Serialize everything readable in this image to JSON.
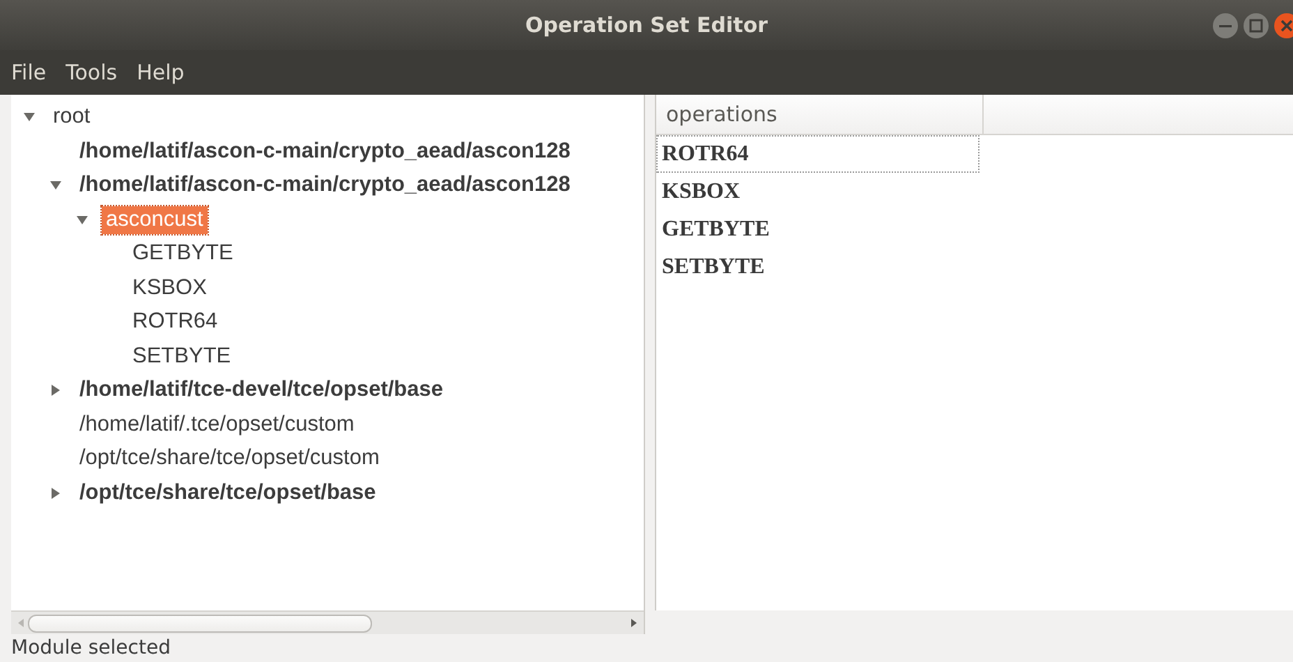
{
  "window": {
    "title": "Operation Set Editor"
  },
  "menu": [
    "File",
    "Tools",
    "Help"
  ],
  "tree": [
    {
      "label": "root",
      "bold": false,
      "expanded": true,
      "selected": false,
      "children": [
        {
          "label": "/home/latif/ascon-c-main/crypto_aead/ascon128",
          "bold": true,
          "selected": false
        },
        {
          "label": "/home/latif/ascon-c-main/crypto_aead/ascon128",
          "bold": true,
          "expanded": true,
          "selected": false,
          "children": [
            {
              "label": "asconcust",
              "bold": false,
              "expanded": true,
              "selected": true,
              "children": [
                {
                  "label": "GETBYTE",
                  "bold": false,
                  "selected": false
                },
                {
                  "label": "KSBOX",
                  "bold": false,
                  "selected": false
                },
                {
                  "label": "ROTR64",
                  "bold": false,
                  "selected": false
                },
                {
                  "label": "SETBYTE",
                  "bold": false,
                  "selected": false
                }
              ]
            }
          ]
        },
        {
          "label": "/home/latif/tce-devel/tce/opset/base",
          "bold": true,
          "expanded": false,
          "selected": false
        },
        {
          "label": "/home/latif/.tce/opset/custom",
          "bold": false,
          "selected": false
        },
        {
          "label": "/opt/tce/share/tce/opset/custom",
          "bold": false,
          "selected": false
        },
        {
          "label": "/opt/tce/share/tce/opset/base",
          "bold": true,
          "expanded": false,
          "selected": false
        }
      ]
    }
  ],
  "table": {
    "columns": [
      "operations"
    ],
    "rows": [
      {
        "cells": [
          "ROTR64"
        ],
        "focused": true
      },
      {
        "cells": [
          "KSBOX"
        ],
        "focused": false
      },
      {
        "cells": [
          "GETBYTE"
        ],
        "focused": false
      },
      {
        "cells": [
          "SETBYTE"
        ],
        "focused": false
      }
    ]
  },
  "status_bar": "Module selected"
}
